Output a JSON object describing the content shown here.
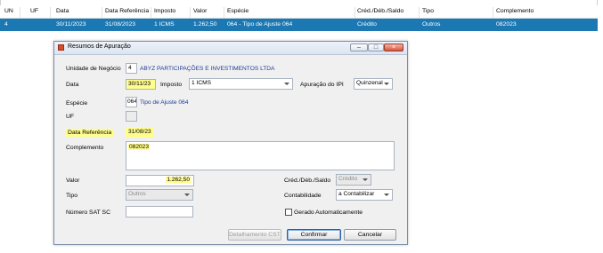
{
  "grid": {
    "headers": [
      "UN",
      "UF",
      "Data",
      "Data Referência",
      "Imposto",
      "Valor",
      "Espécie",
      "Créd./Déb./Saldo",
      "Tipo",
      "Complemento"
    ],
    "row": [
      "4",
      "",
      "30/11/2023",
      "31/08/2023",
      "1 ICMS",
      "1.262,50",
      "064 - Tipo de Ajuste 064",
      "Crédito",
      "Outros",
      "082023"
    ]
  },
  "dialog": {
    "title": "Resumos de Apuração",
    "unidade_label": "Unidade de Negócio",
    "unidade_code": "4",
    "unidade_name": "ABYZ PARTICIPAÇÕES E INVESTIMENTOS LTDA",
    "data_label": "Data",
    "data_value": "30/11/23",
    "imposto_label": "Imposto",
    "imposto_value": "1 ICMS",
    "apuracao_ipi_label": "Apuração do IPI",
    "apuracao_ipi_value": "Quinzenal",
    "especie_label": "Espécie",
    "especie_code": "064",
    "especie_name": "Tipo de Ajuste 064",
    "uf_label": "UF",
    "uf_value": "",
    "data_ref_label": "Data Referência",
    "data_ref_value": "31/08/23",
    "complemento_label": "Complemento",
    "complemento_value": "082023",
    "valor_label": "Valor",
    "valor_value": "1.262,50",
    "cred_deb_label": "Créd./Déb./Saldo",
    "cred_deb_value": "Crédito",
    "tipo_label": "Tipo",
    "tipo_value": "Outros",
    "contabilidade_label": "Contabilidade",
    "contabilidade_value": "a Contabilizar",
    "numero_sat_label": "Número SAT SC",
    "numero_sat_value": "",
    "gerado_label": "Gerado Automaticamente",
    "btn_detalhamento": "Detalhamento CST",
    "btn_confirmar": "Confirmar",
    "btn_cancelar": "Cancelar"
  }
}
